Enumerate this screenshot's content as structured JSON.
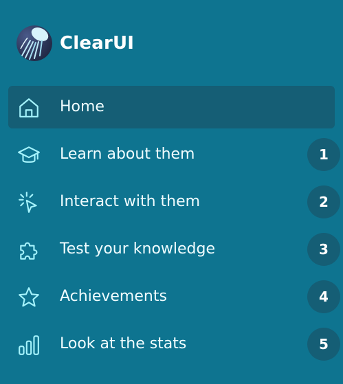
{
  "brand": {
    "name": "ClearUI",
    "logo_icon": "jellyfish-logo"
  },
  "nav": {
    "items": [
      {
        "label": "Home",
        "icon": "home-icon",
        "active": true,
        "badge": null
      },
      {
        "label": "Learn about them",
        "icon": "graduation-cap-icon",
        "active": false,
        "badge": "1"
      },
      {
        "label": "Interact with them",
        "icon": "cursor-click-icon",
        "active": false,
        "badge": "2"
      },
      {
        "label": "Test your knowledge",
        "icon": "puzzle-icon",
        "active": false,
        "badge": "3"
      },
      {
        "label": "Achievements",
        "icon": "star-icon",
        "active": false,
        "badge": "4"
      },
      {
        "label": "Look at the stats",
        "icon": "bar-chart-icon",
        "active": false,
        "badge": "5"
      }
    ]
  },
  "colors": {
    "background": "#0e7490",
    "active_item": "#155e75",
    "badge": "#155e75",
    "icon": "#a5f3fc",
    "text": "#f0fdff"
  }
}
